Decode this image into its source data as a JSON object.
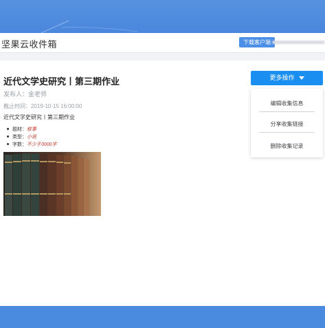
{
  "header": {
    "app_title": "坚果云收件箱",
    "download_label": "下载客户端"
  },
  "form": {
    "title": "近代文学史研究丨第三期作业",
    "publisher": "发布人：金老师",
    "deadline": "截止时间：2019-10-15 16:00:00",
    "description_title": "近代文学史研究丨第三期作业",
    "requirements": [
      {
        "label": "题材：",
        "value": "叙事"
      },
      {
        "label": "类型：",
        "value": "小说"
      },
      {
        "label": "字数：",
        "value": "不少于3000字"
      }
    ]
  },
  "actions": {
    "more_label": "更多操作",
    "menu": [
      "编辑收集信息",
      "分享收集链接",
      "删除收集记录"
    ]
  },
  "colors": {
    "top_band": "#4a86dc",
    "primary_button": "#1a8ff1",
    "download_button": "#4c8fe6",
    "emphasis_text": "#c0392b"
  }
}
